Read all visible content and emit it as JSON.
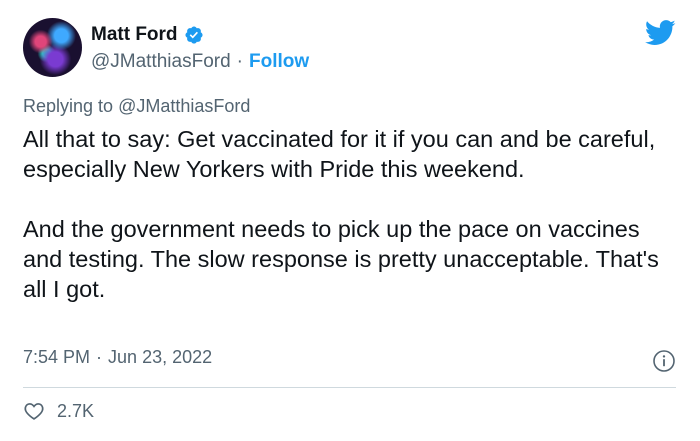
{
  "author": {
    "name": "Matt Ford",
    "handle": "@JMatthiasFord",
    "separator": "·",
    "follow_label": "Follow"
  },
  "reply": {
    "prefix": "Replying to",
    "mention": "@JMatthiasFord"
  },
  "tweet": {
    "paragraph_1": "All that to say: Get vaccinated for it if you can and be careful, especially New Yorkers with Pride this weekend.",
    "paragraph_2": "And the government needs to pick up the pace on vaccines and testing. The slow response is pretty unacceptable. That's all I got."
  },
  "meta": {
    "time": "7:54 PM",
    "separator": "·",
    "date": "Jun 23, 2022"
  },
  "engagement": {
    "likes": "2.7K"
  },
  "icons": {
    "verified": "verified-badge-icon",
    "twitter": "twitter-bird-icon",
    "info": "info-icon",
    "like": "heart-icon"
  },
  "colors": {
    "accent": "#1d9bf0",
    "text": "#0f1419",
    "muted": "#536471",
    "divider": "#cfd9de"
  }
}
